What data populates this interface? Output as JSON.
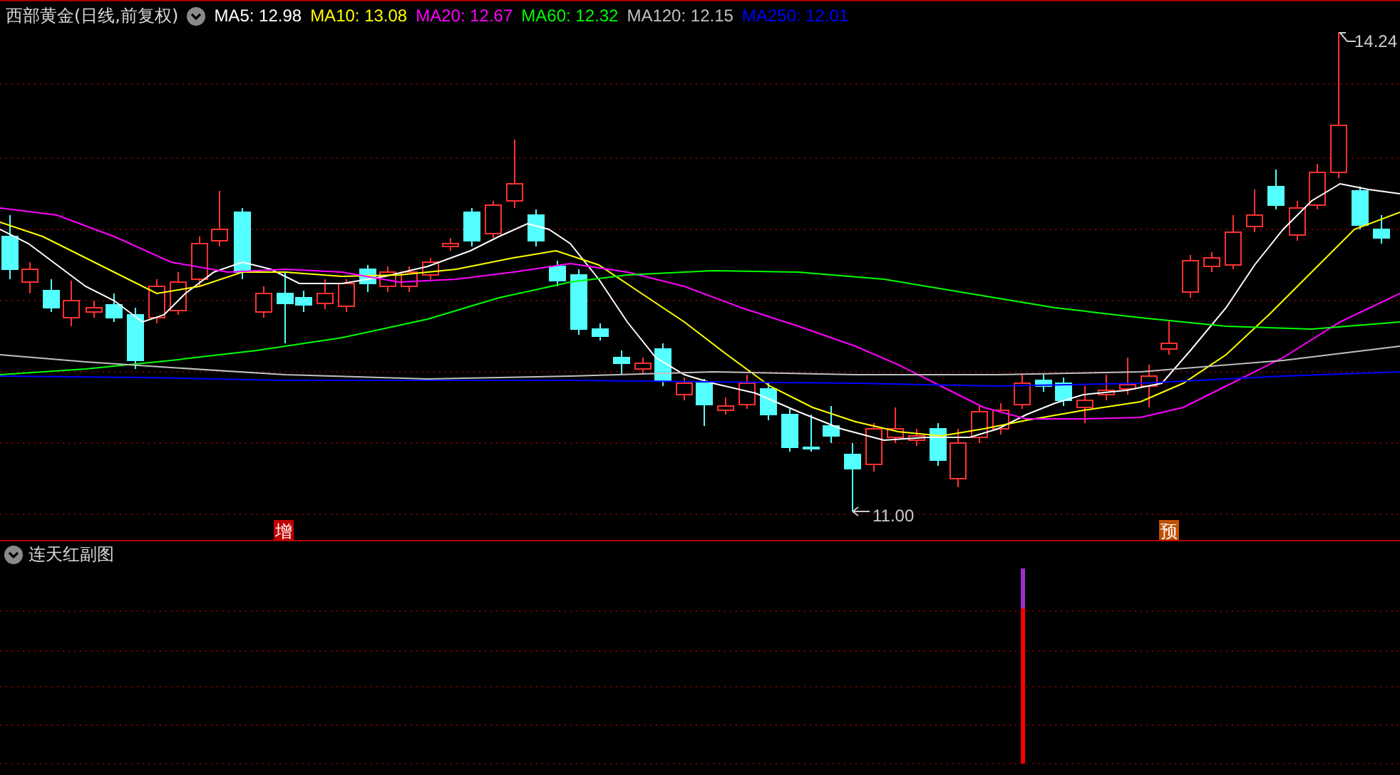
{
  "main_chart": {
    "title": "西部黄金(日线,前复权)",
    "indicators": [
      {
        "label": "MA5:",
        "value": "12.98",
        "color": "#ffffff"
      },
      {
        "label": "MA10:",
        "value": "13.08",
        "color": "#ffff00"
      },
      {
        "label": "MA20:",
        "value": "12.67",
        "color": "#ff00ff"
      },
      {
        "label": "MA60:",
        "value": "12.32",
        "color": "#00ff00"
      },
      {
        "label": "MA120:",
        "value": "12.15",
        "color": "#c0c0c0"
      },
      {
        "label": "MA250:",
        "value": "12.01",
        "color": "#0000ff"
      }
    ],
    "high_label": "14.24",
    "low_label": "11.00",
    "markers": [
      {
        "text": "增",
        "color": "#c00000"
      },
      {
        "text": "预",
        "color": "#c05000"
      }
    ]
  },
  "sub_chart": {
    "title": "连天红副图"
  }
}
